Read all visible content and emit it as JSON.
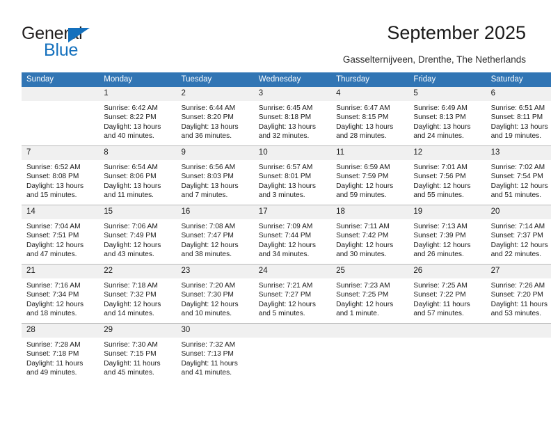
{
  "brand": {
    "name_part1": "General",
    "name_part2": "Blue",
    "triangle_icon": "blue-triangle-icon",
    "accent_color": "#1470bd"
  },
  "header": {
    "title": "September 2025",
    "subtitle": "Gasselternijveen, Drenthe, The Netherlands",
    "header_bg_color": "#3175b4",
    "daynum_bg_color": "#f0f0f0"
  },
  "weekdays": [
    "Sunday",
    "Monday",
    "Tuesday",
    "Wednesday",
    "Thursday",
    "Friday",
    "Saturday"
  ],
  "weeks": [
    [
      {
        "day": "",
        "sunrise": "",
        "sunset": "",
        "daylight1": "",
        "daylight2": ""
      },
      {
        "day": "1",
        "sunrise": "Sunrise: 6:42 AM",
        "sunset": "Sunset: 8:22 PM",
        "daylight1": "Daylight: 13 hours",
        "daylight2": "and 40 minutes."
      },
      {
        "day": "2",
        "sunrise": "Sunrise: 6:44 AM",
        "sunset": "Sunset: 8:20 PM",
        "daylight1": "Daylight: 13 hours",
        "daylight2": "and 36 minutes."
      },
      {
        "day": "3",
        "sunrise": "Sunrise: 6:45 AM",
        "sunset": "Sunset: 8:18 PM",
        "daylight1": "Daylight: 13 hours",
        "daylight2": "and 32 minutes."
      },
      {
        "day": "4",
        "sunrise": "Sunrise: 6:47 AM",
        "sunset": "Sunset: 8:15 PM",
        "daylight1": "Daylight: 13 hours",
        "daylight2": "and 28 minutes."
      },
      {
        "day": "5",
        "sunrise": "Sunrise: 6:49 AM",
        "sunset": "Sunset: 8:13 PM",
        "daylight1": "Daylight: 13 hours",
        "daylight2": "and 24 minutes."
      },
      {
        "day": "6",
        "sunrise": "Sunrise: 6:51 AM",
        "sunset": "Sunset: 8:11 PM",
        "daylight1": "Daylight: 13 hours",
        "daylight2": "and 19 minutes."
      }
    ],
    [
      {
        "day": "7",
        "sunrise": "Sunrise: 6:52 AM",
        "sunset": "Sunset: 8:08 PM",
        "daylight1": "Daylight: 13 hours",
        "daylight2": "and 15 minutes."
      },
      {
        "day": "8",
        "sunrise": "Sunrise: 6:54 AM",
        "sunset": "Sunset: 8:06 PM",
        "daylight1": "Daylight: 13 hours",
        "daylight2": "and 11 minutes."
      },
      {
        "day": "9",
        "sunrise": "Sunrise: 6:56 AM",
        "sunset": "Sunset: 8:03 PM",
        "daylight1": "Daylight: 13 hours",
        "daylight2": "and 7 minutes."
      },
      {
        "day": "10",
        "sunrise": "Sunrise: 6:57 AM",
        "sunset": "Sunset: 8:01 PM",
        "daylight1": "Daylight: 13 hours",
        "daylight2": "and 3 minutes."
      },
      {
        "day": "11",
        "sunrise": "Sunrise: 6:59 AM",
        "sunset": "Sunset: 7:59 PM",
        "daylight1": "Daylight: 12 hours",
        "daylight2": "and 59 minutes."
      },
      {
        "day": "12",
        "sunrise": "Sunrise: 7:01 AM",
        "sunset": "Sunset: 7:56 PM",
        "daylight1": "Daylight: 12 hours",
        "daylight2": "and 55 minutes."
      },
      {
        "day": "13",
        "sunrise": "Sunrise: 7:02 AM",
        "sunset": "Sunset: 7:54 PM",
        "daylight1": "Daylight: 12 hours",
        "daylight2": "and 51 minutes."
      }
    ],
    [
      {
        "day": "14",
        "sunrise": "Sunrise: 7:04 AM",
        "sunset": "Sunset: 7:51 PM",
        "daylight1": "Daylight: 12 hours",
        "daylight2": "and 47 minutes."
      },
      {
        "day": "15",
        "sunrise": "Sunrise: 7:06 AM",
        "sunset": "Sunset: 7:49 PM",
        "daylight1": "Daylight: 12 hours",
        "daylight2": "and 43 minutes."
      },
      {
        "day": "16",
        "sunrise": "Sunrise: 7:08 AM",
        "sunset": "Sunset: 7:47 PM",
        "daylight1": "Daylight: 12 hours",
        "daylight2": "and 38 minutes."
      },
      {
        "day": "17",
        "sunrise": "Sunrise: 7:09 AM",
        "sunset": "Sunset: 7:44 PM",
        "daylight1": "Daylight: 12 hours",
        "daylight2": "and 34 minutes."
      },
      {
        "day": "18",
        "sunrise": "Sunrise: 7:11 AM",
        "sunset": "Sunset: 7:42 PM",
        "daylight1": "Daylight: 12 hours",
        "daylight2": "and 30 minutes."
      },
      {
        "day": "19",
        "sunrise": "Sunrise: 7:13 AM",
        "sunset": "Sunset: 7:39 PM",
        "daylight1": "Daylight: 12 hours",
        "daylight2": "and 26 minutes."
      },
      {
        "day": "20",
        "sunrise": "Sunrise: 7:14 AM",
        "sunset": "Sunset: 7:37 PM",
        "daylight1": "Daylight: 12 hours",
        "daylight2": "and 22 minutes."
      }
    ],
    [
      {
        "day": "21",
        "sunrise": "Sunrise: 7:16 AM",
        "sunset": "Sunset: 7:34 PM",
        "daylight1": "Daylight: 12 hours",
        "daylight2": "and 18 minutes."
      },
      {
        "day": "22",
        "sunrise": "Sunrise: 7:18 AM",
        "sunset": "Sunset: 7:32 PM",
        "daylight1": "Daylight: 12 hours",
        "daylight2": "and 14 minutes."
      },
      {
        "day": "23",
        "sunrise": "Sunrise: 7:20 AM",
        "sunset": "Sunset: 7:30 PM",
        "daylight1": "Daylight: 12 hours",
        "daylight2": "and 10 minutes."
      },
      {
        "day": "24",
        "sunrise": "Sunrise: 7:21 AM",
        "sunset": "Sunset: 7:27 PM",
        "daylight1": "Daylight: 12 hours",
        "daylight2": "and 5 minutes."
      },
      {
        "day": "25",
        "sunrise": "Sunrise: 7:23 AM",
        "sunset": "Sunset: 7:25 PM",
        "daylight1": "Daylight: 12 hours",
        "daylight2": "and 1 minute."
      },
      {
        "day": "26",
        "sunrise": "Sunrise: 7:25 AM",
        "sunset": "Sunset: 7:22 PM",
        "daylight1": "Daylight: 11 hours",
        "daylight2": "and 57 minutes."
      },
      {
        "day": "27",
        "sunrise": "Sunrise: 7:26 AM",
        "sunset": "Sunset: 7:20 PM",
        "daylight1": "Daylight: 11 hours",
        "daylight2": "and 53 minutes."
      }
    ],
    [
      {
        "day": "28",
        "sunrise": "Sunrise: 7:28 AM",
        "sunset": "Sunset: 7:18 PM",
        "daylight1": "Daylight: 11 hours",
        "daylight2": "and 49 minutes."
      },
      {
        "day": "29",
        "sunrise": "Sunrise: 7:30 AM",
        "sunset": "Sunset: 7:15 PM",
        "daylight1": "Daylight: 11 hours",
        "daylight2": "and 45 minutes."
      },
      {
        "day": "30",
        "sunrise": "Sunrise: 7:32 AM",
        "sunset": "Sunset: 7:13 PM",
        "daylight1": "Daylight: 11 hours",
        "daylight2": "and 41 minutes."
      },
      {
        "day": "",
        "sunrise": "",
        "sunset": "",
        "daylight1": "",
        "daylight2": ""
      },
      {
        "day": "",
        "sunrise": "",
        "sunset": "",
        "daylight1": "",
        "daylight2": ""
      },
      {
        "day": "",
        "sunrise": "",
        "sunset": "",
        "daylight1": "",
        "daylight2": ""
      },
      {
        "day": "",
        "sunrise": "",
        "sunset": "",
        "daylight1": "",
        "daylight2": ""
      }
    ]
  ]
}
